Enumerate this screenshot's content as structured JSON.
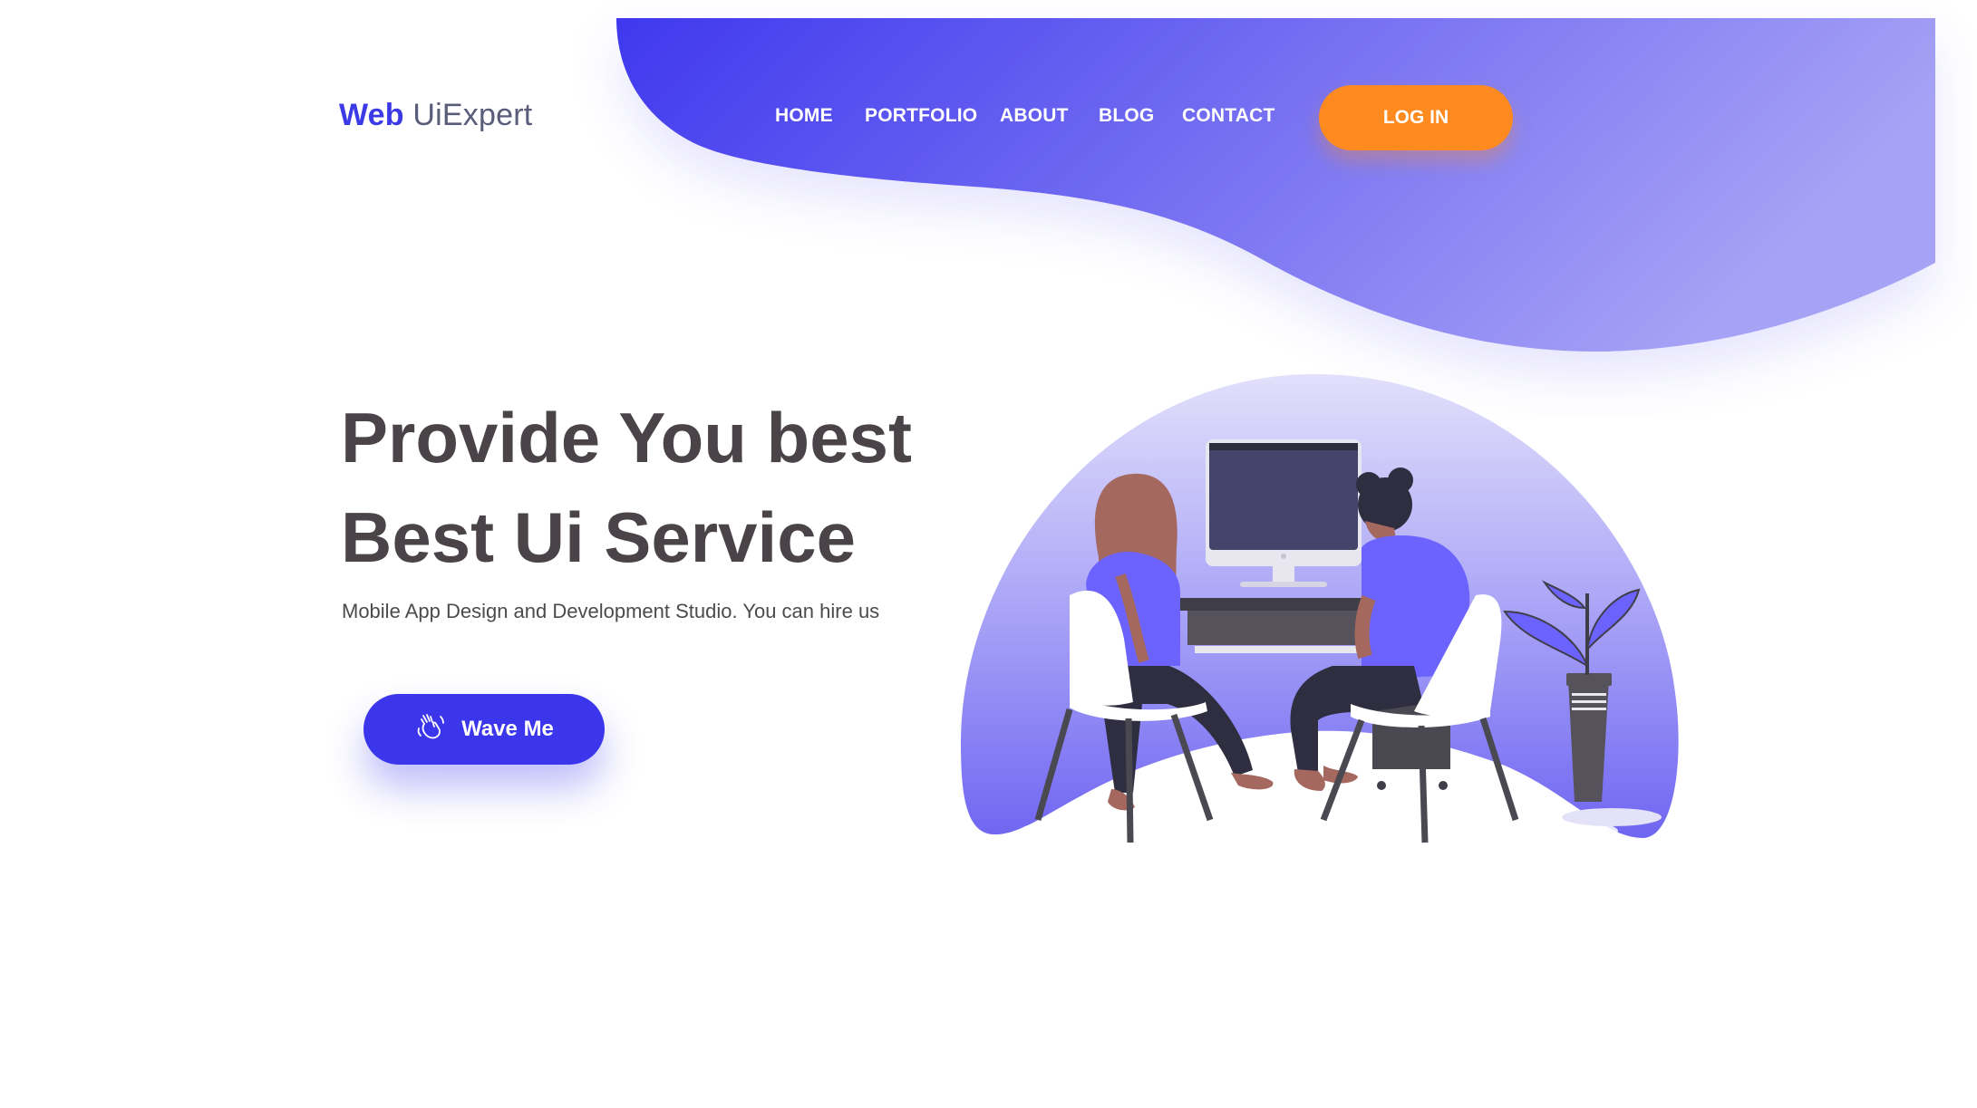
{
  "brand": {
    "first": "Web",
    "second": " UiExpert"
  },
  "nav": {
    "items": [
      "HOME",
      "PORTFOLIO",
      "ABOUT",
      "BLOG",
      "CONTACT"
    ],
    "login_label": "LOG IN"
  },
  "hero": {
    "title_line1": "Provide You best",
    "title_line2": "Best Ui Service",
    "subtitle": "Mobile App Design and Development Studio. You can hire us",
    "cta_label": "Wave Me",
    "cta_icon": "waving-hand-icon"
  },
  "colors": {
    "primary": "#3b35ec",
    "accent": "#ff8a1f",
    "gradient_start": "#3f38ee",
    "gradient_end": "#a6a2f5",
    "heading": "#4a4448"
  }
}
